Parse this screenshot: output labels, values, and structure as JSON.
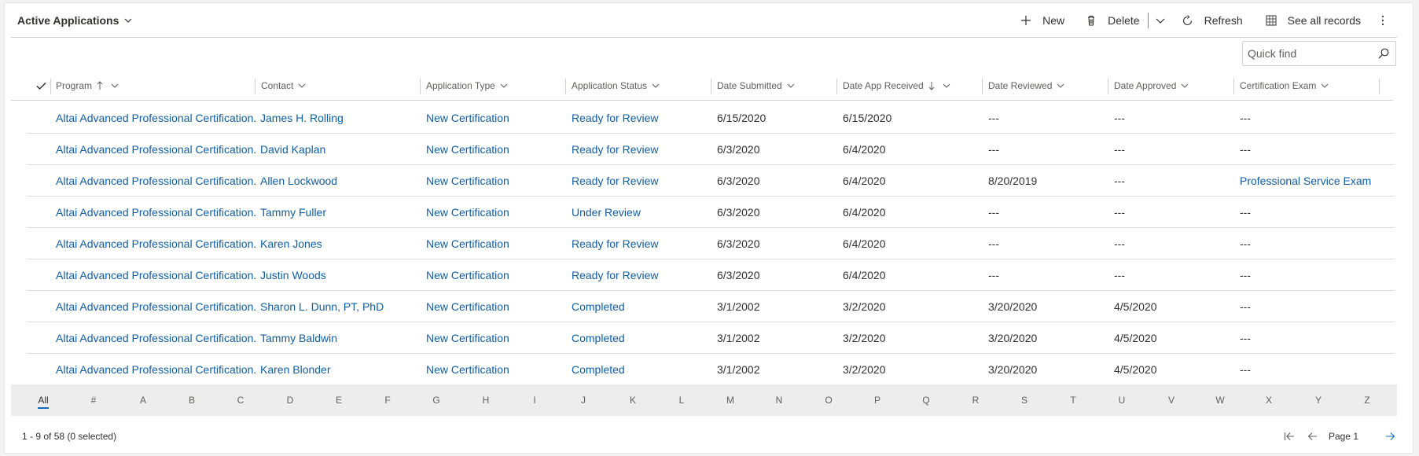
{
  "view": {
    "title": "Active Applications"
  },
  "commands": {
    "new": "New",
    "delete": "Delete",
    "refresh": "Refresh",
    "see_all": "See all records"
  },
  "search": {
    "placeholder": "Quick find"
  },
  "columns": [
    {
      "label": "Program"
    },
    {
      "label": "Contact"
    },
    {
      "label": "Application Type"
    },
    {
      "label": "Application Status"
    },
    {
      "label": "Date Submitted"
    },
    {
      "label": "Date App Received"
    },
    {
      "label": "Date Reviewed"
    },
    {
      "label": "Date Approved"
    },
    {
      "label": "Certification Exam"
    }
  ],
  "rows": [
    [
      "Altai Advanced Professional Certification.",
      "James H. Rolling",
      "New Certification",
      "Ready for Review",
      "6/15/2020",
      "6/15/2020",
      "---",
      "---",
      "---"
    ],
    [
      "Altai Advanced Professional Certification.",
      "David Kaplan",
      "New Certification",
      "Ready for Review",
      "6/3/2020",
      "6/4/2020",
      "---",
      "---",
      "---"
    ],
    [
      "Altai Advanced Professional Certification.",
      "Allen Lockwood",
      "New Certification",
      "Ready for Review",
      "6/3/2020",
      "6/4/2020",
      "8/20/2019",
      "---",
      "Professional Service Exam"
    ],
    [
      "Altai Advanced Professional Certification.",
      "Tammy Fuller",
      "New Certification",
      "Under Review",
      "6/3/2020",
      "6/4/2020",
      "---",
      "---",
      "---"
    ],
    [
      "Altai Advanced Professional Certification.",
      "Karen Jones",
      "New Certification",
      "Ready for Review",
      "6/3/2020",
      "6/4/2020",
      "---",
      "---",
      "---"
    ],
    [
      "Altai Advanced Professional Certification.",
      "Justin Woods",
      "New Certification",
      "Ready for Review",
      "6/3/2020",
      "6/4/2020",
      "---",
      "---",
      "---"
    ],
    [
      "Altai Advanced Professional Certification.",
      "Sharon L. Dunn, PT, PhD",
      "New Certification",
      "Completed",
      "3/1/2002",
      "3/2/2020",
      "3/20/2020",
      "4/5/2020",
      "---"
    ],
    [
      "Altai Advanced Professional Certification.",
      "Tammy Baldwin",
      "New Certification",
      "Completed",
      "3/1/2002",
      "3/2/2020",
      "3/20/2020",
      "4/5/2020",
      "---"
    ],
    [
      "Altai Advanced Professional Certification.",
      "Karen Blonder",
      "New Certification",
      "Completed",
      "3/1/2002",
      "3/2/2020",
      "3/20/2020",
      "4/5/2020",
      "---"
    ]
  ],
  "jump_letters": [
    "All",
    "#",
    "A",
    "B",
    "C",
    "D",
    "E",
    "F",
    "G",
    "H",
    "I",
    "J",
    "K",
    "L",
    "M",
    "N",
    "O",
    "P",
    "Q",
    "R",
    "S",
    "T",
    "U",
    "V",
    "W",
    "X",
    "Y",
    "Z"
  ],
  "footer": {
    "status": "1 - 9 of 58 (0 selected)",
    "page": "Page 1"
  },
  "colors": {
    "link": "#115ea3",
    "accent": "#0f6cbd",
    "text": "#323130",
    "muted": "#605e5c"
  },
  "icons": [
    "chevron-down-icon",
    "add-icon",
    "delete-icon",
    "refresh-icon",
    "grid-icon",
    "more-icon",
    "search-icon",
    "checkmark-icon",
    "sort-up-icon",
    "sort-down-icon",
    "first-page-icon",
    "previous-page-icon",
    "next-page-icon"
  ]
}
